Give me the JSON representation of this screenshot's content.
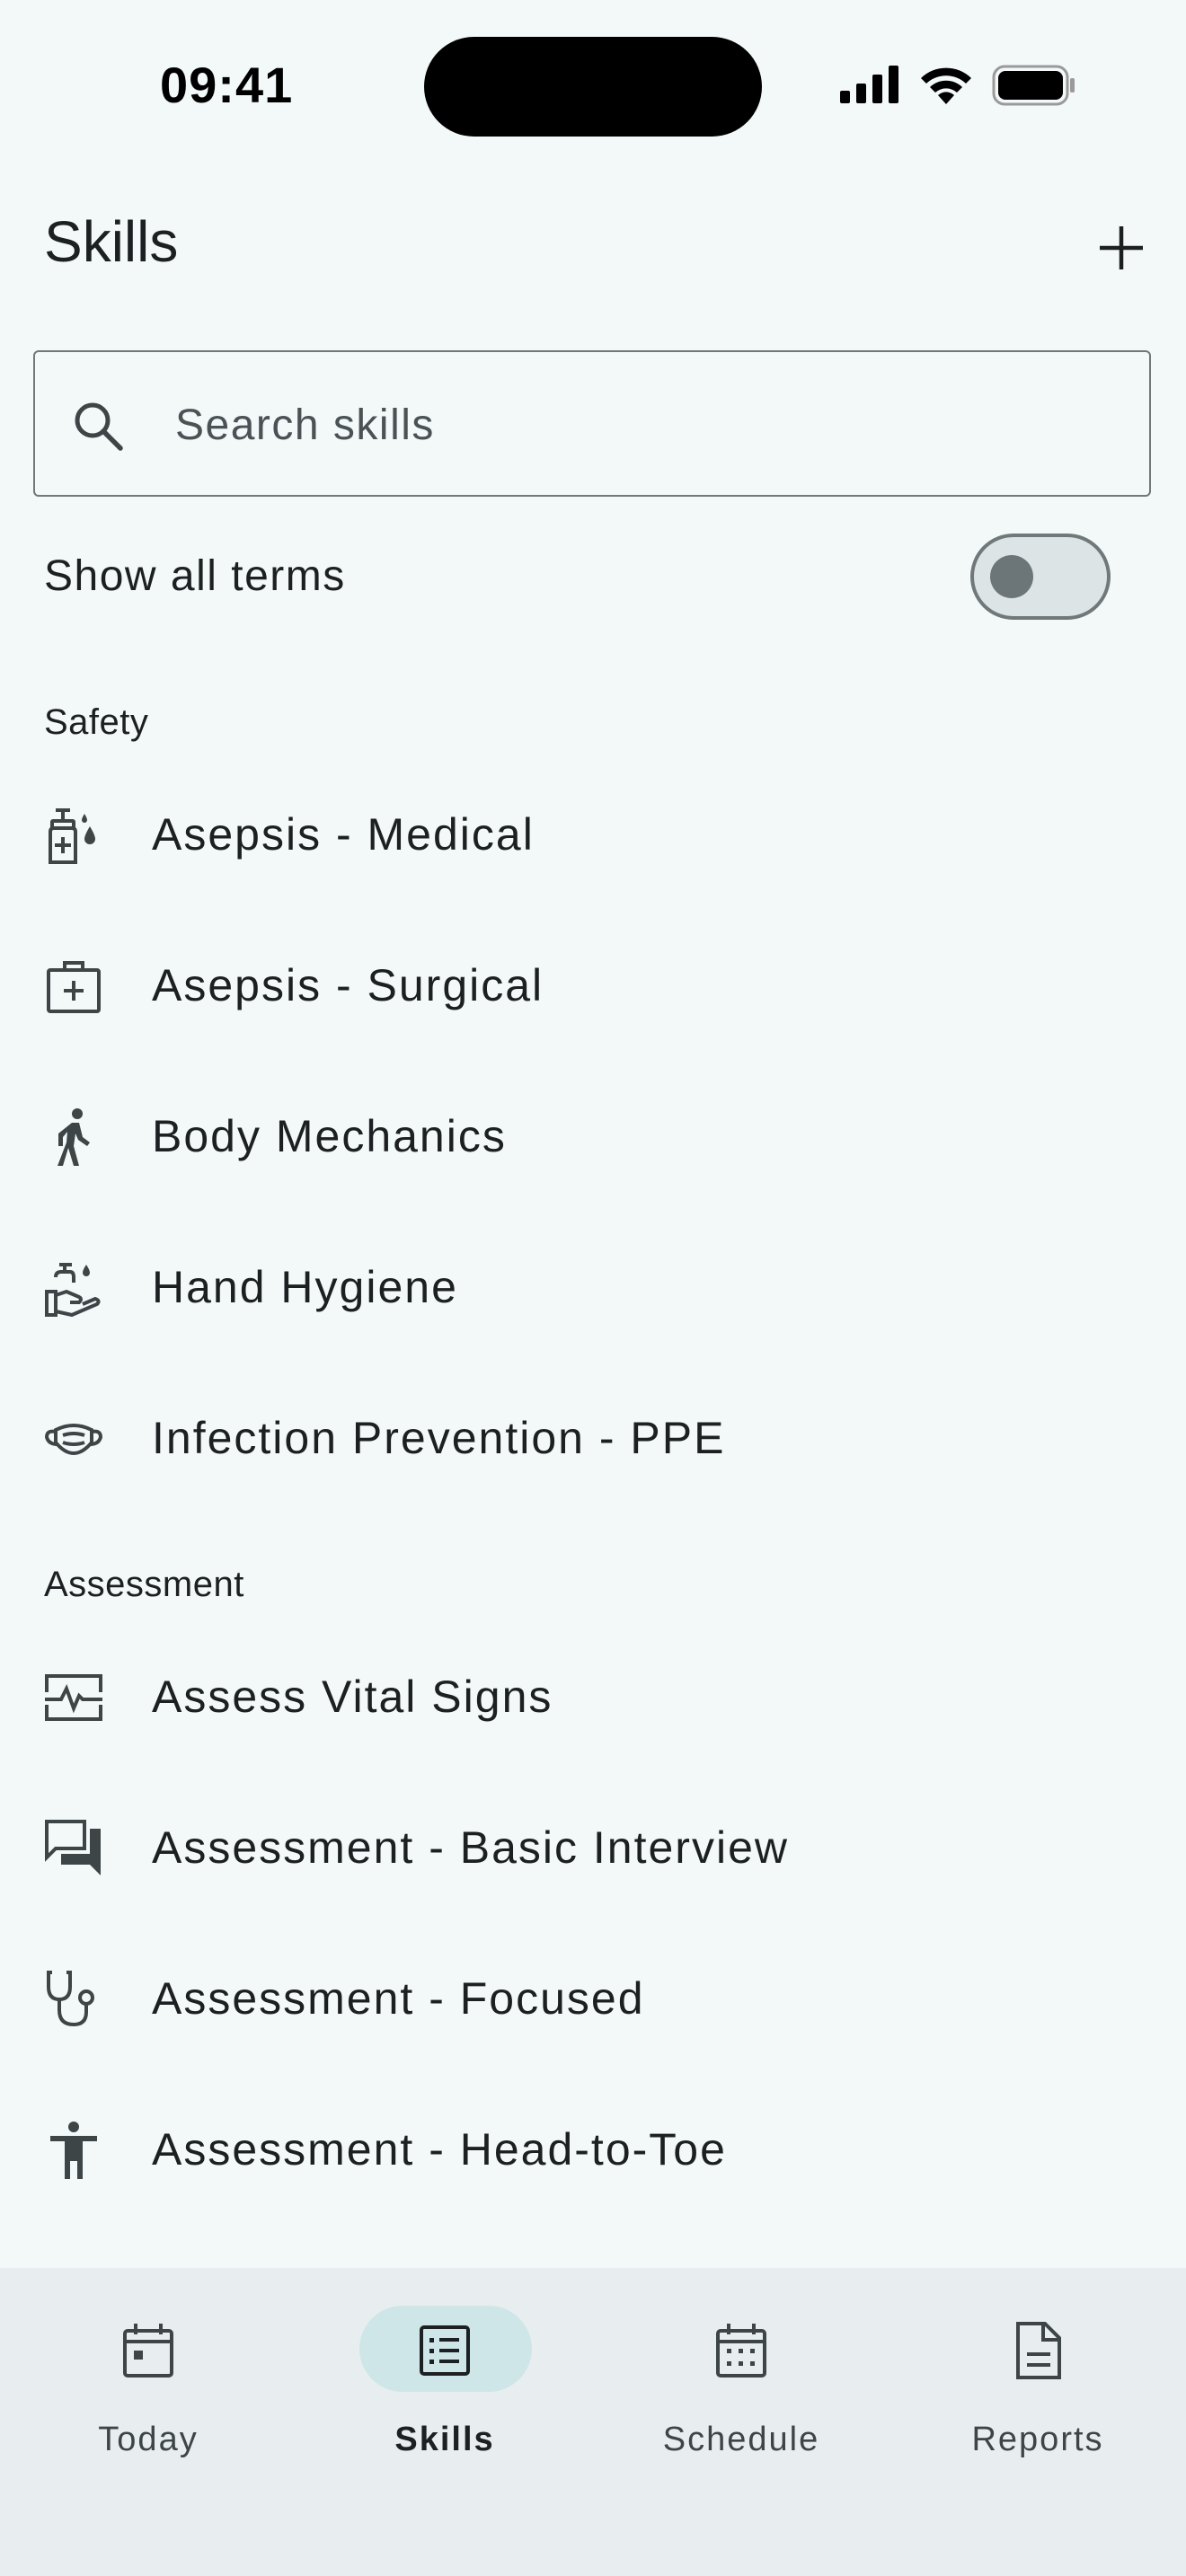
{
  "status_bar": {
    "time": "09:41"
  },
  "header": {
    "title": "Skills"
  },
  "search": {
    "placeholder": "Search skills",
    "value": ""
  },
  "toggle": {
    "label": "Show all terms",
    "checked": false
  },
  "sections": [
    {
      "title": "Safety",
      "items": [
        {
          "label": "Asepsis - Medical",
          "icon": "sanitizer-icon"
        },
        {
          "label": "Asepsis - Surgical",
          "icon": "medical-kit-icon"
        },
        {
          "label": "Body Mechanics",
          "icon": "walking-person-icon"
        },
        {
          "label": "Hand Hygiene",
          "icon": "hand-wash-icon"
        },
        {
          "label": "Infection Prevention - PPE",
          "icon": "mask-icon"
        }
      ]
    },
    {
      "title": "Assessment",
      "items": [
        {
          "label": "Assess Vital Signs",
          "icon": "monitor-heart-icon"
        },
        {
          "label": "Assessment - Basic Interview",
          "icon": "chat-bubbles-icon"
        },
        {
          "label": "Assessment - Focused",
          "icon": "stethoscope-icon"
        },
        {
          "label": "Assessment - Head-to-Toe",
          "icon": "person-icon"
        }
      ]
    }
  ],
  "bottom_nav": [
    {
      "label": "Today",
      "icon": "calendar-today-icon",
      "active": false
    },
    {
      "label": "Skills",
      "icon": "list-icon",
      "active": true
    },
    {
      "label": "Schedule",
      "icon": "calendar-grid-icon",
      "active": false
    },
    {
      "label": "Reports",
      "icon": "document-icon",
      "active": false
    }
  ],
  "colors": {
    "background": "#f3f8f9",
    "nav_background": "#e8eeef",
    "active_pill": "#cfe6e8",
    "text": "#1c2022"
  }
}
